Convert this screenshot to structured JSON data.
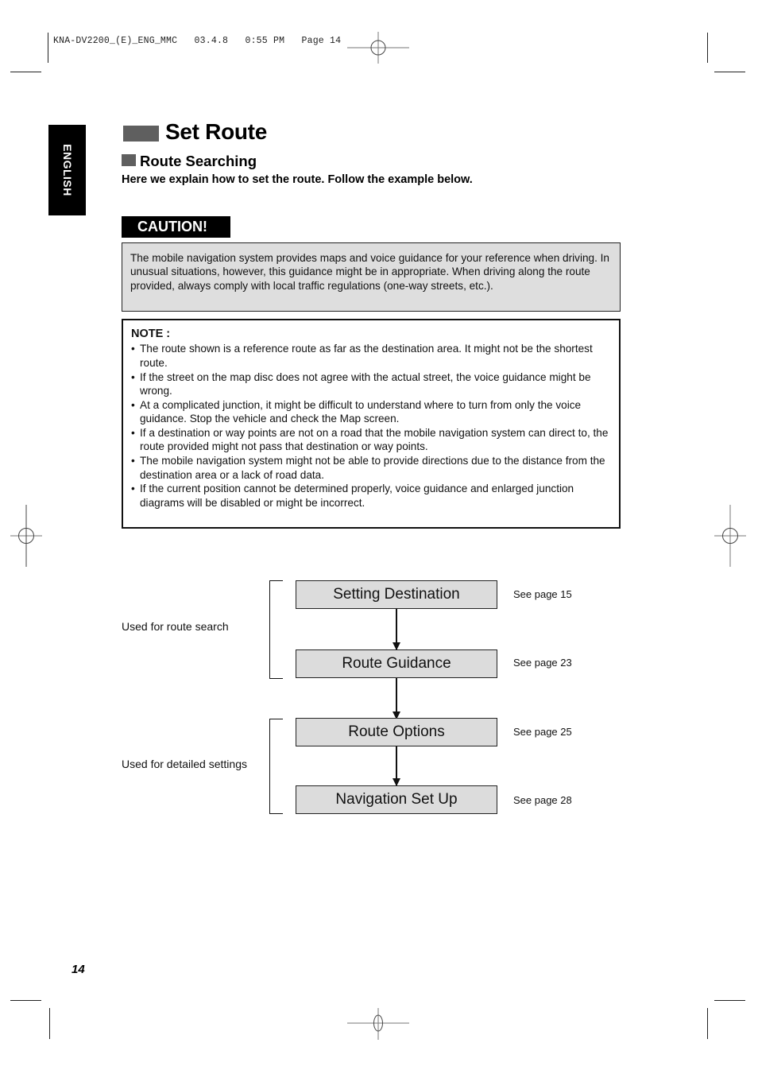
{
  "print_header": {
    "file": "KNA-DV2200_(E)_ENG_MMC",
    "date": "03.4.8",
    "time": "0:55 PM",
    "page_label": "Page 14"
  },
  "language_tab": "ENGLISH",
  "title": "Set Route",
  "section": {
    "subtitle": "Route Searching",
    "intro": "Here we explain how to set the route. Follow the example below."
  },
  "caution": {
    "label": "CAUTION!",
    "text": "The mobile navigation system provides maps and voice guidance for your reference when driving. In unusual situations, however, this guidance might be in appropriate. When driving along the route provided, always comply with local traffic regulations (one-way streets, etc.)."
  },
  "note": {
    "title": "NOTE :",
    "bullet": "•",
    "items": [
      "The route shown is a reference route as far as the destination area. It might not be the shortest route.",
      "If the street on the map disc does not agree with the actual street, the voice guidance might be wrong.",
      "At a complicated junction, it might be difficult to understand where to turn from only the voice guidance. Stop the vehicle and check the Map screen.",
      "If a destination or way points are not on a road that the mobile navigation system can direct to, the route provided might not pass that destination or way points.",
      "The mobile navigation system might not be able to provide directions due to the distance from the destination area or a lack of road data.",
      "If the current position cannot be determined properly, voice guidance and enlarged junction diagrams will be disabled or might be incorrect."
    ]
  },
  "flow": {
    "groups": [
      {
        "label": "Used for route search"
      },
      {
        "label": "Used for detailed settings"
      }
    ],
    "steps": [
      {
        "label": "Setting Destination",
        "reference": "See page 15"
      },
      {
        "label": "Route Guidance",
        "reference": "See page 23"
      },
      {
        "label": "Route Options",
        "reference": "See page 25"
      },
      {
        "label": "Navigation Set Up",
        "reference": "See page 28"
      }
    ]
  },
  "page_number": "14"
}
